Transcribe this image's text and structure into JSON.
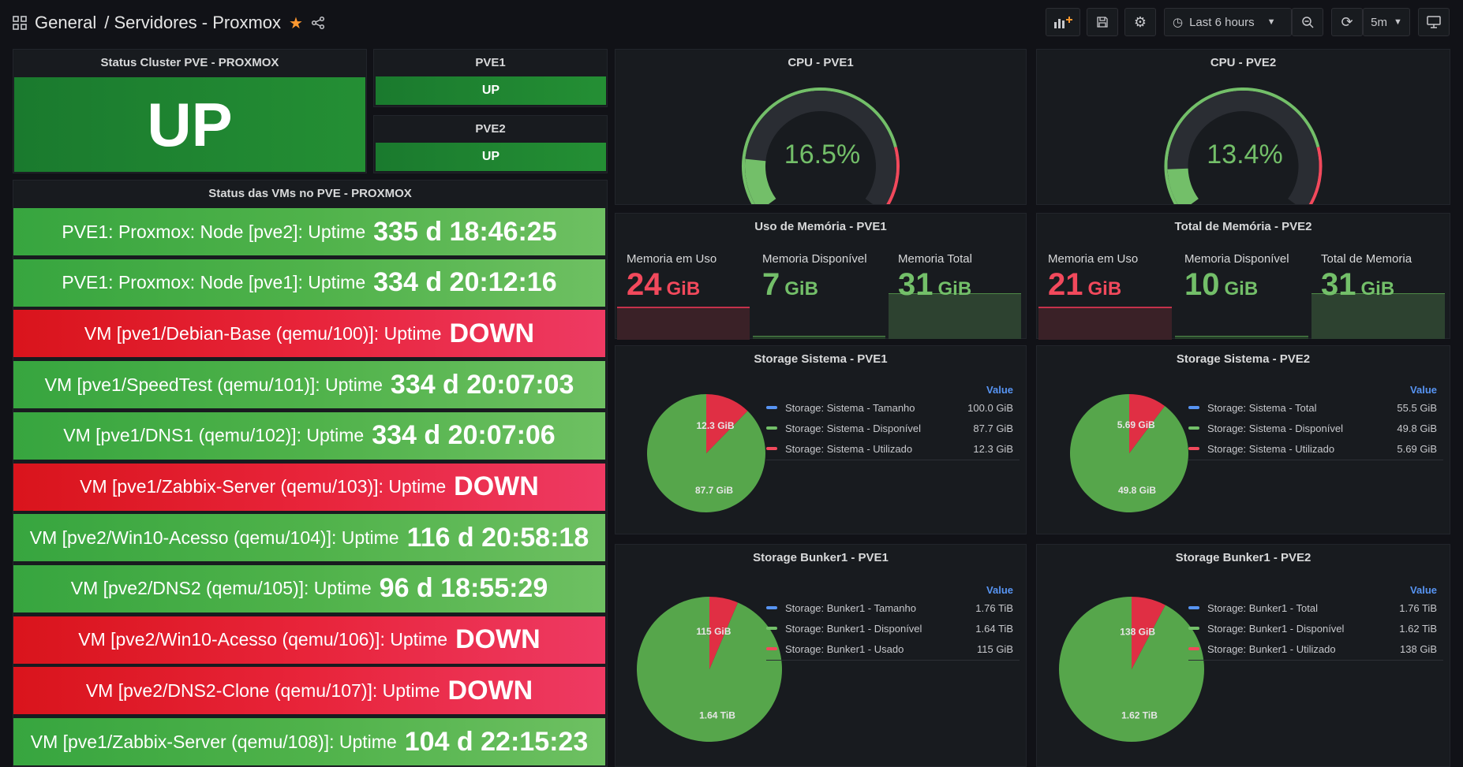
{
  "header": {
    "breadcrumb_folder": "General",
    "breadcrumb_title": "/ Servidores - Proxmox",
    "time_range": "Last 6 hours",
    "refresh_interval": "5m"
  },
  "cluster_status": {
    "title": "Status Cluster PVE - PROXMOX",
    "value": "UP"
  },
  "pve1_status": {
    "title": "PVE1",
    "value": "UP"
  },
  "pve2_status": {
    "title": "PVE2",
    "value": "UP"
  },
  "vm_panel": {
    "title": "Status das VMs no PVE - PROXMOX",
    "rows": [
      {
        "label": "PVE1: Proxmox: Node [pve2]: Uptime",
        "value": "335 d 18:46:25",
        "state": "up"
      },
      {
        "label": "PVE1: Proxmox: Node [pve1]: Uptime",
        "value": "334 d 20:12:16",
        "state": "up"
      },
      {
        "label": "VM [pve1/Debian-Base (qemu/100)]: Uptime",
        "value": "DOWN",
        "state": "down"
      },
      {
        "label": "VM [pve1/SpeedTest (qemu/101)]: Uptime",
        "value": "334 d 20:07:03",
        "state": "up"
      },
      {
        "label": "VM [pve1/DNS1 (qemu/102)]: Uptime",
        "value": "334 d 20:07:06",
        "state": "up"
      },
      {
        "label": "VM [pve1/Zabbix-Server (qemu/103)]: Uptime",
        "value": "DOWN",
        "state": "down"
      },
      {
        "label": "VM [pve2/Win10-Acesso (qemu/104)]: Uptime",
        "value": "116 d 20:58:18",
        "state": "up"
      },
      {
        "label": "VM [pve2/DNS2 (qemu/105)]: Uptime",
        "value": "96 d 18:55:29",
        "state": "up"
      },
      {
        "label": "VM [pve2/Win10-Acesso (qemu/106)]: Uptime",
        "value": "DOWN",
        "state": "down"
      },
      {
        "label": "VM [pve2/DNS2-Clone (qemu/107)]: Uptime",
        "value": "DOWN",
        "state": "down"
      },
      {
        "label": "VM [pve1/Zabbix-Server (qemu/108)]: Uptime",
        "value": "104 d 22:15:23",
        "state": "up"
      }
    ]
  },
  "cpu_pve1": {
    "title": "CPU - PVE1",
    "value": "16.5%",
    "percent": 16.5
  },
  "cpu_pve2": {
    "title": "CPU - PVE2",
    "value": "13.4%",
    "percent": 13.4
  },
  "mem_pve1": {
    "title": "Uso de Memória - PVE1",
    "stats": [
      {
        "label": "Memoria em Uso",
        "value": "24",
        "unit": "GiB",
        "color": "#f2495c"
      },
      {
        "label": "Memoria Disponível",
        "value": "7",
        "unit": "GiB",
        "color": "#73bf69"
      },
      {
        "label": "Memoria Total",
        "value": "31",
        "unit": "GiB",
        "color": "#73bf69"
      }
    ]
  },
  "mem_pve2": {
    "title": "Total de Memória - PVE2",
    "stats": [
      {
        "label": "Memoria em Uso",
        "value": "21",
        "unit": "GiB",
        "color": "#f2495c"
      },
      {
        "label": "Memoria Disponível",
        "value": "10",
        "unit": "GiB",
        "color": "#73bf69"
      },
      {
        "label": "Total de Memoria",
        "value": "31",
        "unit": "GiB",
        "color": "#73bf69"
      }
    ]
  },
  "storage_sys_pve1": {
    "title": "Storage Sistema - PVE1",
    "legend_header": "Value",
    "legend": [
      {
        "name": "Storage: Sistema - Tamanho",
        "value": "100.0 GiB",
        "color": "#5794f2"
      },
      {
        "name": "Storage: Sistema - Disponível",
        "value": "87.7 GiB",
        "color": "#73bf69"
      },
      {
        "name": "Storage: Sistema - Utilizado",
        "value": "12.3 GiB",
        "color": "#f2495c"
      }
    ],
    "used_label": "12.3 GiB",
    "free_label": "87.7 GiB",
    "used_fraction": 0.123
  },
  "storage_sys_pve2": {
    "title": "Storage Sistema - PVE2",
    "legend_header": "Value",
    "legend": [
      {
        "name": "Storage: Sistema - Total",
        "value": "55.5 GiB",
        "color": "#5794f2"
      },
      {
        "name": "Storage: Sistema - Disponível",
        "value": "49.8 GiB",
        "color": "#73bf69"
      },
      {
        "name": "Storage: Sistema - Utilizado",
        "value": "5.69 GiB",
        "color": "#f2495c"
      }
    ],
    "used_label": "5.69 GiB",
    "free_label": "49.8 GiB",
    "used_fraction": 0.1025
  },
  "storage_bunker_pve1": {
    "title": "Storage Bunker1 - PVE1",
    "legend_header": "Value",
    "legend": [
      {
        "name": "Storage: Bunker1 - Tamanho",
        "value": "1.76 TiB",
        "color": "#5794f2"
      },
      {
        "name": "Storage: Bunker1 - Disponível",
        "value": "1.64 TiB",
        "color": "#73bf69"
      },
      {
        "name": "Storage: Bunker1 - Usado",
        "value": "115 GiB",
        "color": "#f2495c"
      }
    ],
    "used_label": "115 GiB",
    "free_label": "1.64 TiB",
    "used_fraction": 0.064
  },
  "storage_bunker_pve2": {
    "title": "Storage Bunker1 - PVE2",
    "legend_header": "Value",
    "legend": [
      {
        "name": "Storage: Bunker1 - Total",
        "value": "1.76 TiB",
        "color": "#5794f2"
      },
      {
        "name": "Storage: Bunker1 - Disponível",
        "value": "1.62 TiB",
        "color": "#73bf69"
      },
      {
        "name": "Storage: Bunker1 - Utilizado",
        "value": "138 GiB",
        "color": "#f2495c"
      }
    ],
    "used_label": "138 GiB",
    "free_label": "1.62 TiB",
    "used_fraction": 0.077
  }
}
